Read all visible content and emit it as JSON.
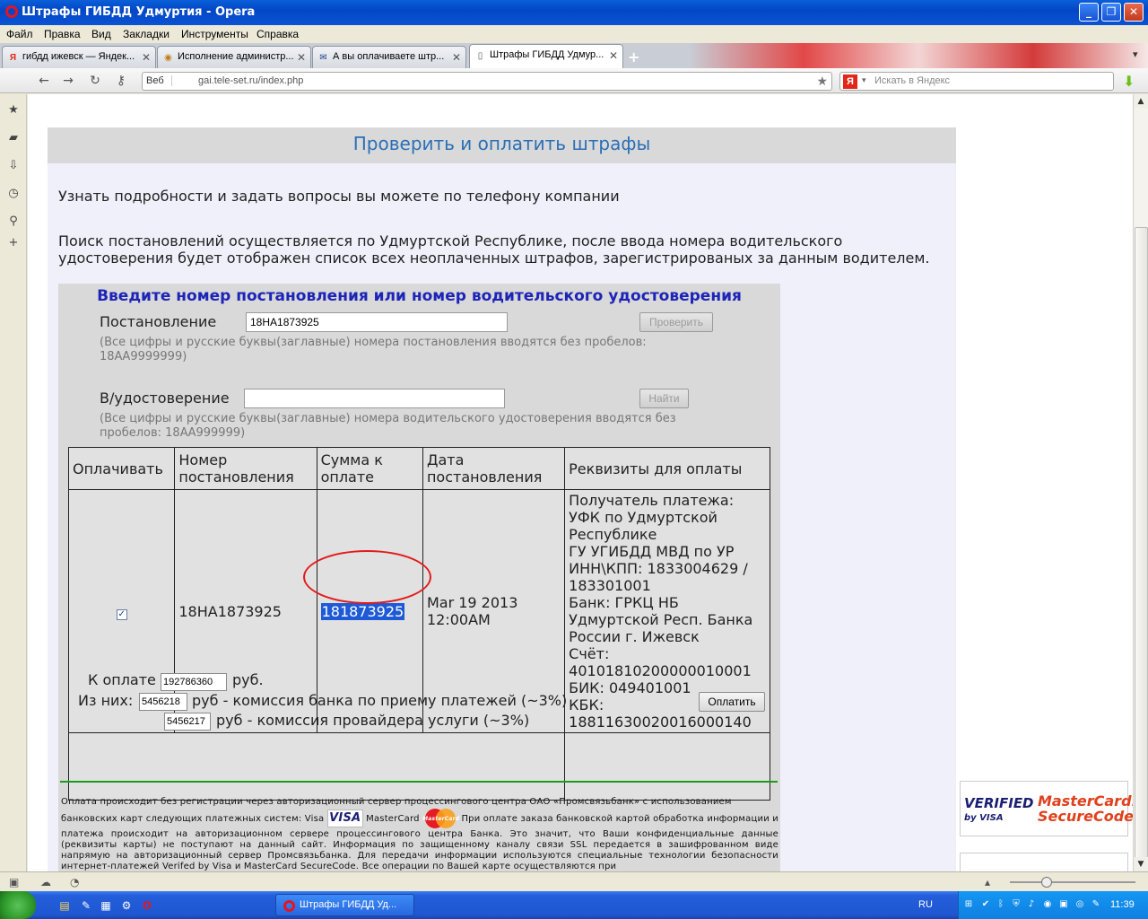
{
  "window": {
    "title": "Штрафы ГИБДД Удмуртия - Opera"
  },
  "menu": [
    "Файл",
    "Правка",
    "Вид",
    "Закладки",
    "Инструменты",
    "Справка"
  ],
  "tabs": [
    {
      "label": "гибдд ижевск — Яндек...",
      "icon": "yandex-icon"
    },
    {
      "label": "Исполнение администр...",
      "icon": "site-icon"
    },
    {
      "label": "А вы оплачиваете штр...",
      "icon": "mail-icon"
    },
    {
      "label": "Штрафы ГИБДД Удмур...",
      "icon": "page-icon",
      "active": true
    }
  ],
  "address": {
    "web_label": "Веб",
    "url": "gai.tele-set.ru/index.php"
  },
  "search": {
    "placeholder": "Искать в Яндекс"
  },
  "page": {
    "title": "Проверить и оплатить штрафы",
    "info1": "Узнать подробности и задать вопросы вы можете по телефону компании",
    "info2": "Поиск постановлений осуществляется по Удмуртской Республике, после ввода номера водительского удостоверения будет отображен список всех неоплаченных штрафов, зарегистрированых за данным водителем."
  },
  "form": {
    "heading": "Введите номер постановления или номер водительского удостоверения",
    "decree_label": "Постановление",
    "decree_value": "18HA1873925",
    "check_button": "Проверить",
    "decree_hint": "(Все цифры и русские буквы(заглавные) номера постановления вводятся без пробелов: 18АА9999999)",
    "license_label": "В/удостоверение",
    "license_value": "",
    "find_button": "Найти",
    "license_hint": "(Все цифры и русские буквы(заглавные) номера водительского удостоверения вводятся без пробелов: 18АА999999)"
  },
  "table": {
    "headers": [
      "Оплачивать",
      "Номер постановления",
      "Сумма к оплате",
      "Дата постановления",
      "Реквизиты для оплаты"
    ],
    "row": {
      "pay_checked": true,
      "number": "18HA1873925",
      "amount": "181873925",
      "date": "Mar 19 2013 12:00AM",
      "details": [
        "Получатель платежа: УФК по Удмуртской Республике",
        "ГУ УГИБДД МВД по УР",
        "ИНН\\КПП: 1833004629 / 183301001",
        "Банк: ГРКЦ НБ Удмуртской Респ. Банка России г. Ижевск",
        "Счёт: 40101810200000010001",
        "БИК: 049401001",
        "КБК: 18811630020016000140"
      ]
    },
    "total_label": "К оплате",
    "total_value": "192786360",
    "currency": "руб.",
    "of_them_label": "Из них:",
    "bank_fee_value": "5456218",
    "bank_fee_text": "руб - комиссия банка по приему платежей (~3%)",
    "provider_fee_value": "5456217",
    "provider_fee_text": "руб - комиссия провайдера услуги (~3%)",
    "pay_button": "Оплатить"
  },
  "footer": {
    "line1": "Оплата происходит без регистрации через авторизационный сервер процессингового центра ОАО «Промсвязьбанк» с использованием",
    "line2a": "банковских карт следующих платежных систем: Visa",
    "visa": "VISA",
    "line2b": "MasterCard",
    "mc": "MasterCard",
    "line2c": "При оплате заказа банковской картой обработка информации и платежа происходит на авторизационном сервере процессингового центра Банка. Это значит, что Ваши конфиденциальные данные (реквизиты карты) не поступают на данный сайт. Информация по защищенному каналу связи SSL передается в зашифрованном виде напрямую на авторизационный сервер Промсвязьбанка. Для передачи информации используются специальные технологии безопасности интернет-платежей Verifed by Visa и MasterCard SecureCode. Все операции по Вашей карте осуществляются при"
  },
  "badges": {
    "vbv_line1": "VERIFIED",
    "vbv_line2": "by VISA",
    "mc_line1": "MasterCard.",
    "mc_line2": "SecureCode."
  },
  "taskbar": {
    "task": "Штрафы ГИБДД Уд...",
    "lang": "RU",
    "time": "11:39"
  },
  "colors": {
    "title_blue": "#2a6fb6",
    "heading_blue": "#1d24b8",
    "highlight": "#1e5ad6",
    "annotation_red": "#e21b1b",
    "divider_green": "#1b9d1b"
  }
}
